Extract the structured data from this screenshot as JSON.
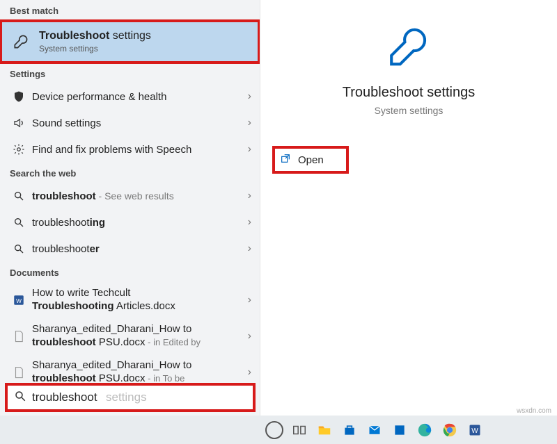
{
  "sections": {
    "best_match": "Best match",
    "settings": "Settings",
    "web": "Search the web",
    "documents": "Documents"
  },
  "selected": {
    "title_bold": "Troubleshoot",
    "title_rest": " settings",
    "subtitle": "System settings"
  },
  "settings_items": [
    {
      "label": "Device performance & health"
    },
    {
      "label": "Sound settings"
    },
    {
      "label": "Find and fix problems with Speech"
    }
  ],
  "web_items": [
    {
      "bold": "troubleshoot",
      "rest": "",
      "hint": " - See web results"
    },
    {
      "bold": "",
      "rest_before": "troubleshoot",
      "rest_bold": "ing",
      "hint": ""
    },
    {
      "bold": "",
      "rest_before": "troubleshoot",
      "rest_bold": "er",
      "hint": ""
    }
  ],
  "doc_items": [
    {
      "line1": "How to write Techcult",
      "line2_bold": "Troubleshooting",
      "line2_rest": " Articles.docx",
      "sub": ""
    },
    {
      "line1": "Sharanya_edited_Dharani_How to",
      "line2_bold": "troubleshoot",
      "line2_rest": " PSU.docx",
      "sub": " - in Edited by"
    },
    {
      "line1": "Sharanya_edited_Dharani_How to",
      "line2_bold": "troubleshoot",
      "line2_rest": " PSU.docx",
      "sub": " - in To be"
    }
  ],
  "search": {
    "value": "troubleshoot",
    "suggestion_suffix": " settings"
  },
  "preview": {
    "title": "Troubleshoot settings",
    "subtitle": "System settings",
    "open": "Open"
  },
  "watermark": "wsxdn.com",
  "colors": {
    "highlight": "#d71a1a",
    "selected_bg": "#bdd7ee",
    "accent_blue": "#0067c0"
  }
}
